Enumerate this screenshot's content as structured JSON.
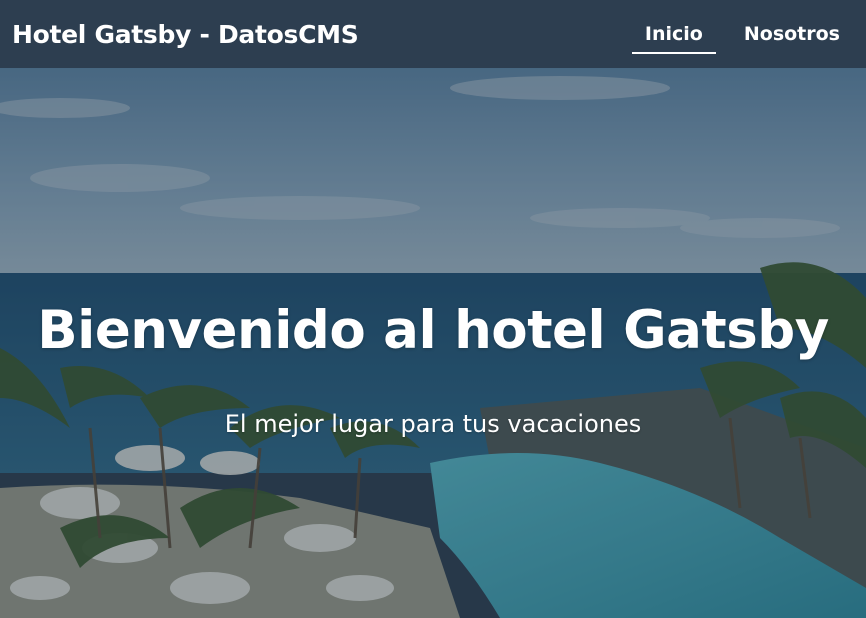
{
  "header": {
    "brand": "Hotel Gatsby - DatosCMS",
    "nav": [
      {
        "label": "Inicio",
        "active": true
      },
      {
        "label": "Nosotros",
        "active": false
      }
    ],
    "background_color": "#2d3e50"
  },
  "hero": {
    "title": "Bienvenido al hotel Gatsby",
    "subtitle": "El mejor lugar para tus vacaciones",
    "image": "hotel-resort-pool-ocean-palms"
  }
}
